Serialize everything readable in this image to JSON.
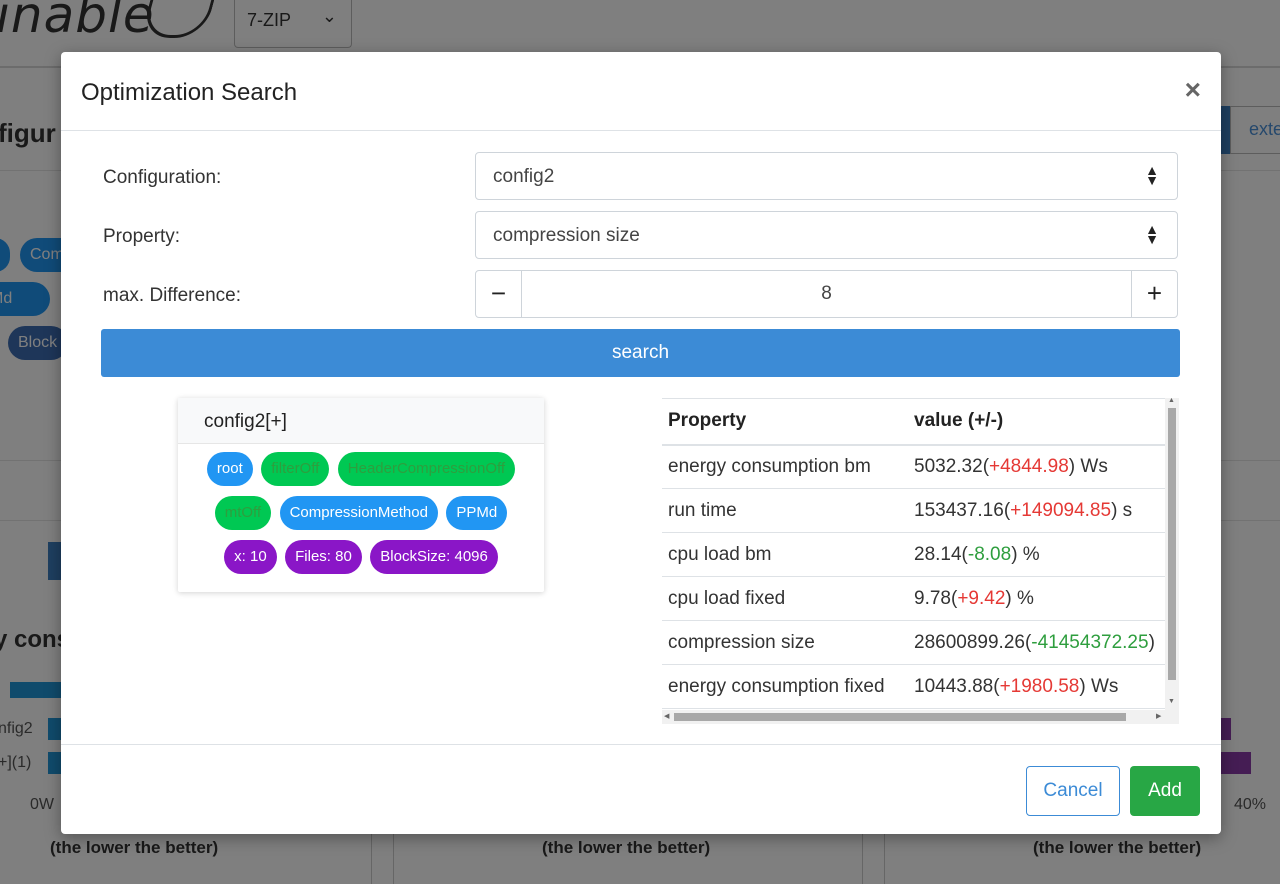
{
  "background": {
    "logo_text": "inable",
    "selected_app": "7-ZIP",
    "section_title": "figur",
    "extend_button": "exte",
    "chips": [
      "Com",
      "Md",
      "Block"
    ],
    "chart_heading": "y cons",
    "row_labels": [
      "nfig2",
      "+](1)"
    ],
    "axis_start": "0W",
    "axis_end": "40%",
    "lower_note": "(the lower the better)"
  },
  "modal": {
    "title": "Optimization Search",
    "close_label": "×",
    "configuration_label": "Configuration:",
    "configuration_value": "config2",
    "property_label": "Property:",
    "property_value": "compression size",
    "max_difference_label": "max. Difference:",
    "max_difference_value": "8",
    "minus_label": "−",
    "plus_label": "+",
    "search_label": "search",
    "cancel_label": "Cancel",
    "add_label": "Add"
  },
  "config_card": {
    "title": "config2[+]",
    "chip_rows": [
      [
        {
          "label": "root",
          "color": "#2196f3"
        },
        {
          "label": "filterOff",
          "color": "#00c853"
        },
        {
          "label": "HeaderCompressionOff",
          "color": "#00c853"
        }
      ],
      [
        {
          "label": "mtOff",
          "color": "#00c853"
        },
        {
          "label": "CompressionMethod",
          "color": "#2196f3"
        },
        {
          "label": "PPMd",
          "color": "#2196f3"
        }
      ],
      [
        {
          "label": "x: 10",
          "color": "#8a16c7"
        },
        {
          "label": "Files: 80",
          "color": "#8a16c7"
        },
        {
          "label": "BlockSize: 4096",
          "color": "#8a16c7"
        }
      ]
    ]
  },
  "result_table": {
    "headers": [
      "Property",
      "value (+/-)"
    ],
    "rows": [
      {
        "property": "energy consumption bm",
        "value": "5032.32",
        "delta": "+4844.98",
        "delta_color": "red",
        "unit": " Ws"
      },
      {
        "property": "run time",
        "value": "153437.16",
        "delta": "+149094.85",
        "delta_color": "red",
        "unit": " s"
      },
      {
        "property": "cpu load bm",
        "value": "28.14",
        "delta": "-8.08",
        "delta_color": "green",
        "unit": " %"
      },
      {
        "property": "cpu load fixed",
        "value": "9.78",
        "delta": "+9.42",
        "delta_color": "red",
        "unit": " %"
      },
      {
        "property": "compression size",
        "value": "28600899.26",
        "delta": "-41454372.25",
        "delta_color": "green",
        "unit": ""
      },
      {
        "property": "energy consumption fixed",
        "value": "10443.88",
        "delta": "+1980.58",
        "delta_color": "red",
        "unit": " Ws"
      }
    ]
  },
  "colors": {
    "primary": "#3c8bd6",
    "success": "#28a745",
    "chip_blue": "#2196f3",
    "chip_green": "#00c853",
    "chip_purple": "#8a16c7",
    "delta_red": "#e53935",
    "delta_green": "#2e9e3e"
  }
}
